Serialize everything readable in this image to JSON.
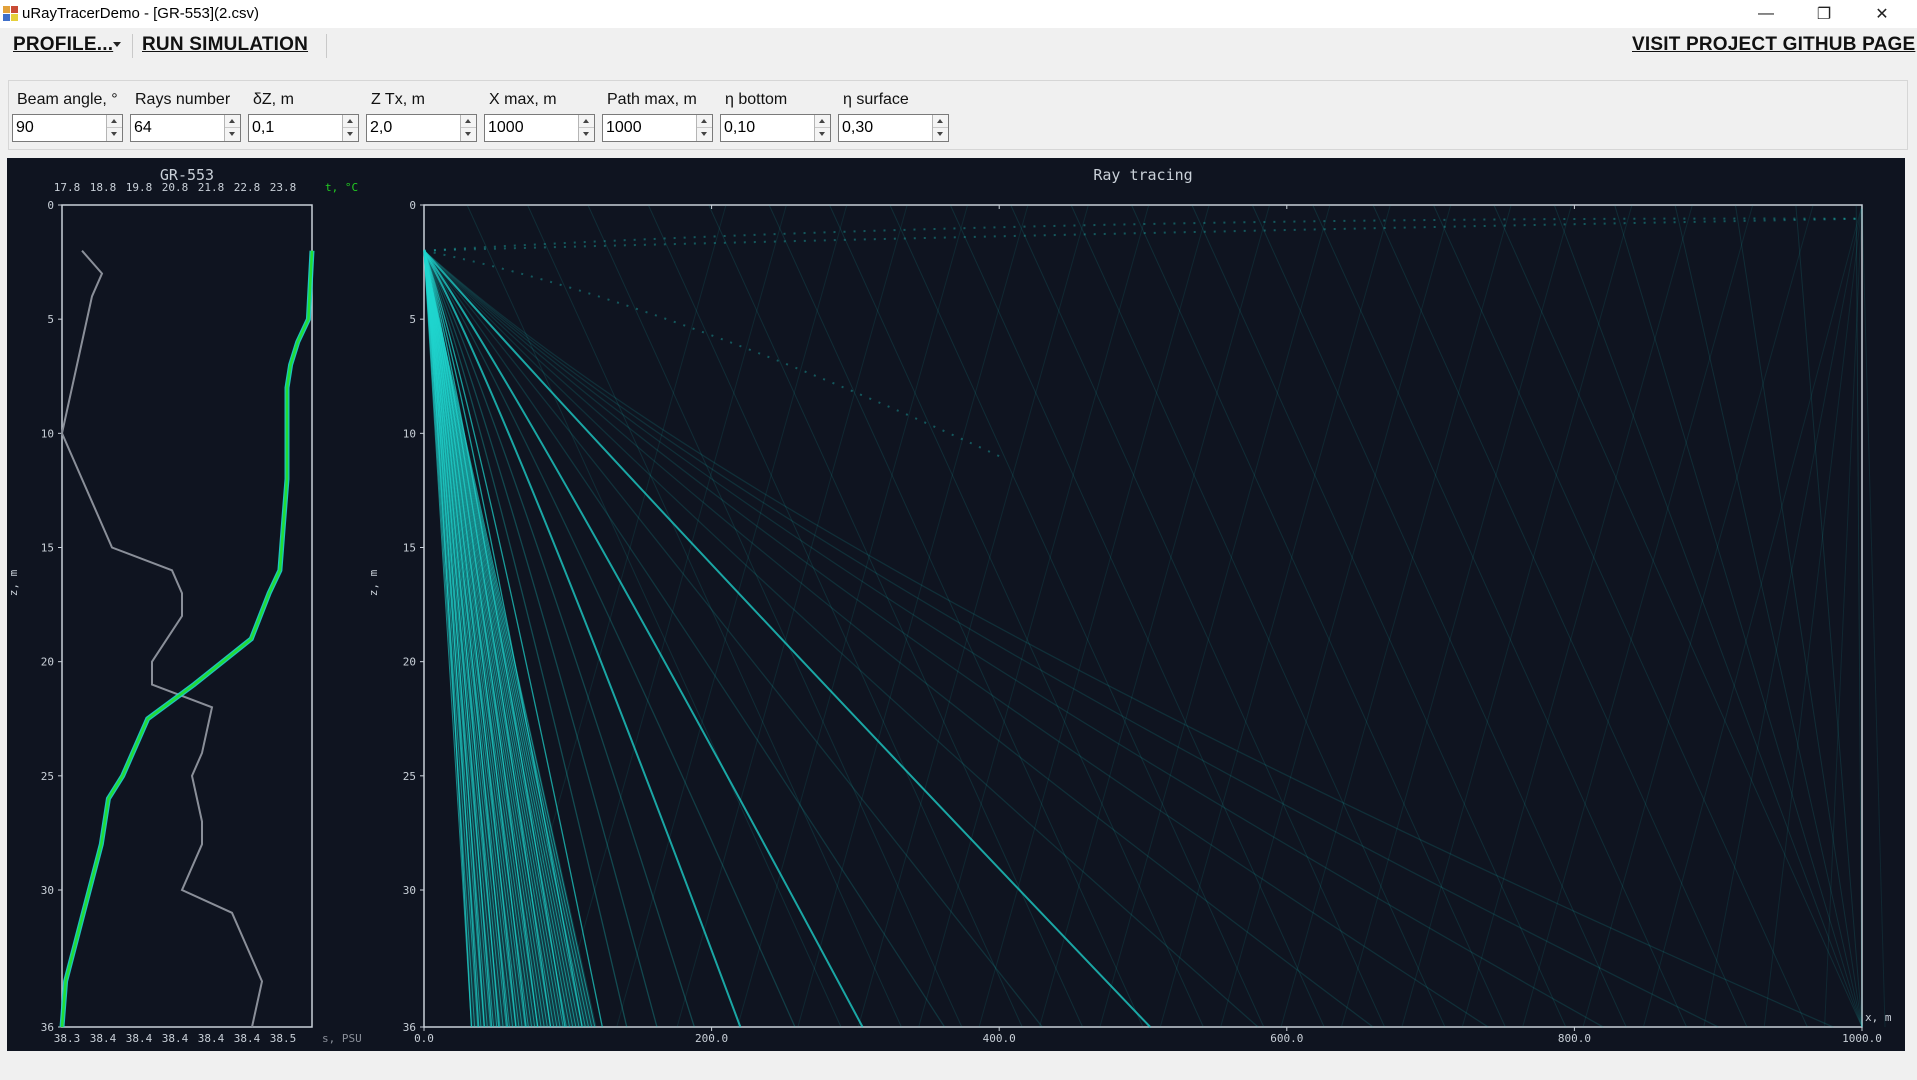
{
  "window": {
    "title": "uRayTracerDemo - [GR-553](2.csv)",
    "minimize": "—",
    "maximize": "❐",
    "close": "✕"
  },
  "menu": {
    "profile": "PROFILE...",
    "run": "RUN SIMULATION",
    "github": "VISIT PROJECT GITHUB PAGE"
  },
  "params": [
    {
      "label": "Beam angle, °",
      "value": "90"
    },
    {
      "label": "Rays number",
      "value": "64"
    },
    {
      "label": "δZ, m",
      "value": "0,1"
    },
    {
      "label": "Z Tx, m",
      "value": "2,0"
    },
    {
      "label": "X max, m",
      "value": "1000"
    },
    {
      "label": "Path max, m",
      "value": "1000"
    },
    {
      "label": "η bottom",
      "value": "0,10"
    },
    {
      "label": "η surface",
      "value": "0,30"
    }
  ],
  "colors": {
    "plot_bg": "#0f1420",
    "axis": "#c9d0d8",
    "ray": "#1fd7d0",
    "temperature": "#22dd33",
    "salinity": "#8a8f99",
    "temp_label": "#22cc22"
  },
  "chart_data": [
    {
      "type": "line",
      "title": "GR-553",
      "ylabel": "z, m",
      "ylim": [
        0,
        36
      ],
      "y_inverted": true,
      "y_ticks": [
        "0",
        "5",
        "10",
        "15",
        "20",
        "25",
        "30",
        "36"
      ],
      "top_axis": {
        "label": "t, °C",
        "ticks": [
          "17.8",
          "18.8",
          "19.8",
          "20.8",
          "21.8",
          "22.8",
          "23.8"
        ],
        "range": [
          17.8,
          24.8
        ]
      },
      "bottom_axis": {
        "label": "s, PSU",
        "ticks": [
          "38.3",
          "38.4",
          "38.4",
          "38.4",
          "38.4",
          "38.4",
          "38.5"
        ],
        "range": [
          38.3,
          38.55
        ]
      },
      "series": [
        {
          "name": "t, °C",
          "x": [
            24.8,
            24.7,
            24.4,
            24.2,
            24.1,
            24.1,
            24.1,
            24.0,
            23.9,
            23.6,
            23.1,
            21.5,
            20.2,
            19.5,
            19.1,
            18.9,
            18.4,
            17.9,
            17.85,
            17.8
          ],
          "y": [
            2,
            5,
            6,
            7,
            8,
            10,
            12,
            14,
            16,
            17,
            19,
            21,
            22.5,
            25,
            26,
            28,
            31,
            34,
            35,
            36
          ]
        },
        {
          "name": "s, PSU",
          "x": [
            38.32,
            38.34,
            38.33,
            38.32,
            38.31,
            38.3,
            38.32,
            38.33,
            38.35,
            38.41,
            38.42,
            38.42,
            38.39,
            38.39,
            38.45,
            38.44,
            38.43,
            38.44,
            38.44,
            38.42,
            38.47,
            38.49,
            38.5,
            38.49
          ],
          "y": [
            2,
            3,
            4,
            6,
            8,
            10,
            12,
            13,
            15,
            16,
            17,
            18,
            20,
            21,
            22,
            24,
            25,
            27,
            28,
            30,
            31,
            33,
            34,
            36
          ]
        }
      ]
    },
    {
      "type": "line",
      "title": "Ray tracing",
      "xlabel": "x, m",
      "ylabel": "z, m",
      "xlim": [
        0,
        1000
      ],
      "ylim": [
        0,
        36
      ],
      "y_inverted": true,
      "x_ticks": [
        "0.0",
        "200.0",
        "400.0",
        "600.0",
        "800.0",
        "1000.0"
      ],
      "y_ticks": [
        "0",
        "5",
        "10",
        "15",
        "20",
        "25",
        "30",
        "36"
      ],
      "source": {
        "x": 0,
        "z": 2
      },
      "rays_number": 64,
      "rays_bottom_x": [
        33,
        38,
        42,
        47,
        52,
        58,
        64,
        71,
        79,
        88,
        98,
        110,
        124,
        141,
        162,
        188,
        220,
        258,
        305,
        362,
        430,
        505,
        580,
        660,
        740,
        820,
        900,
        980
      ],
      "bright_rays_x": [
        150,
        180,
        220,
        260,
        305,
        375,
        460,
        505
      ]
    }
  ]
}
